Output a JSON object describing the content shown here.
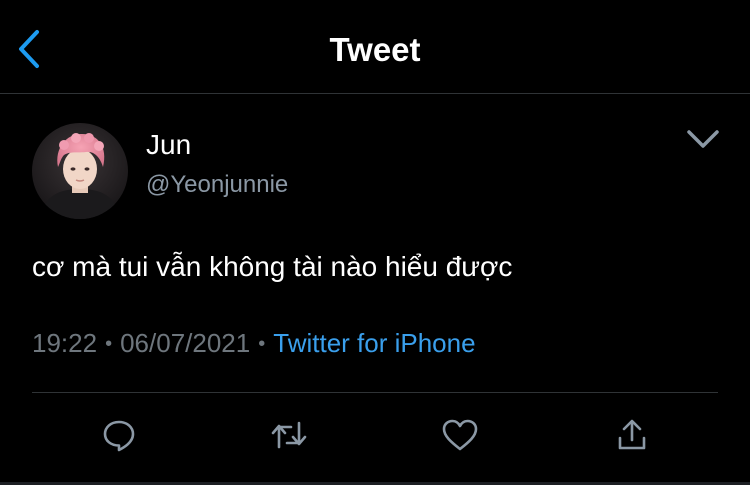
{
  "header": {
    "title": "Tweet",
    "back_icon": "chevron-left-icon"
  },
  "author": {
    "name": "Jun",
    "handle": "@Yeonjunnie"
  },
  "tweet": {
    "text": "cơ mà tui vẫn không tài nào hiểu được",
    "time": "19:22",
    "date": "06/07/2021",
    "separator": "•",
    "source": "Twitter for iPhone"
  },
  "actions": {
    "reply_icon": "reply-icon",
    "retweet_icon": "retweet-icon",
    "like_icon": "heart-icon",
    "share_icon": "share-icon"
  },
  "colors": {
    "background": "#000000",
    "accent": "#1d9bf0",
    "link": "#3a9fec",
    "secondary_text": "#6e767d",
    "divider": "#2f3336"
  }
}
